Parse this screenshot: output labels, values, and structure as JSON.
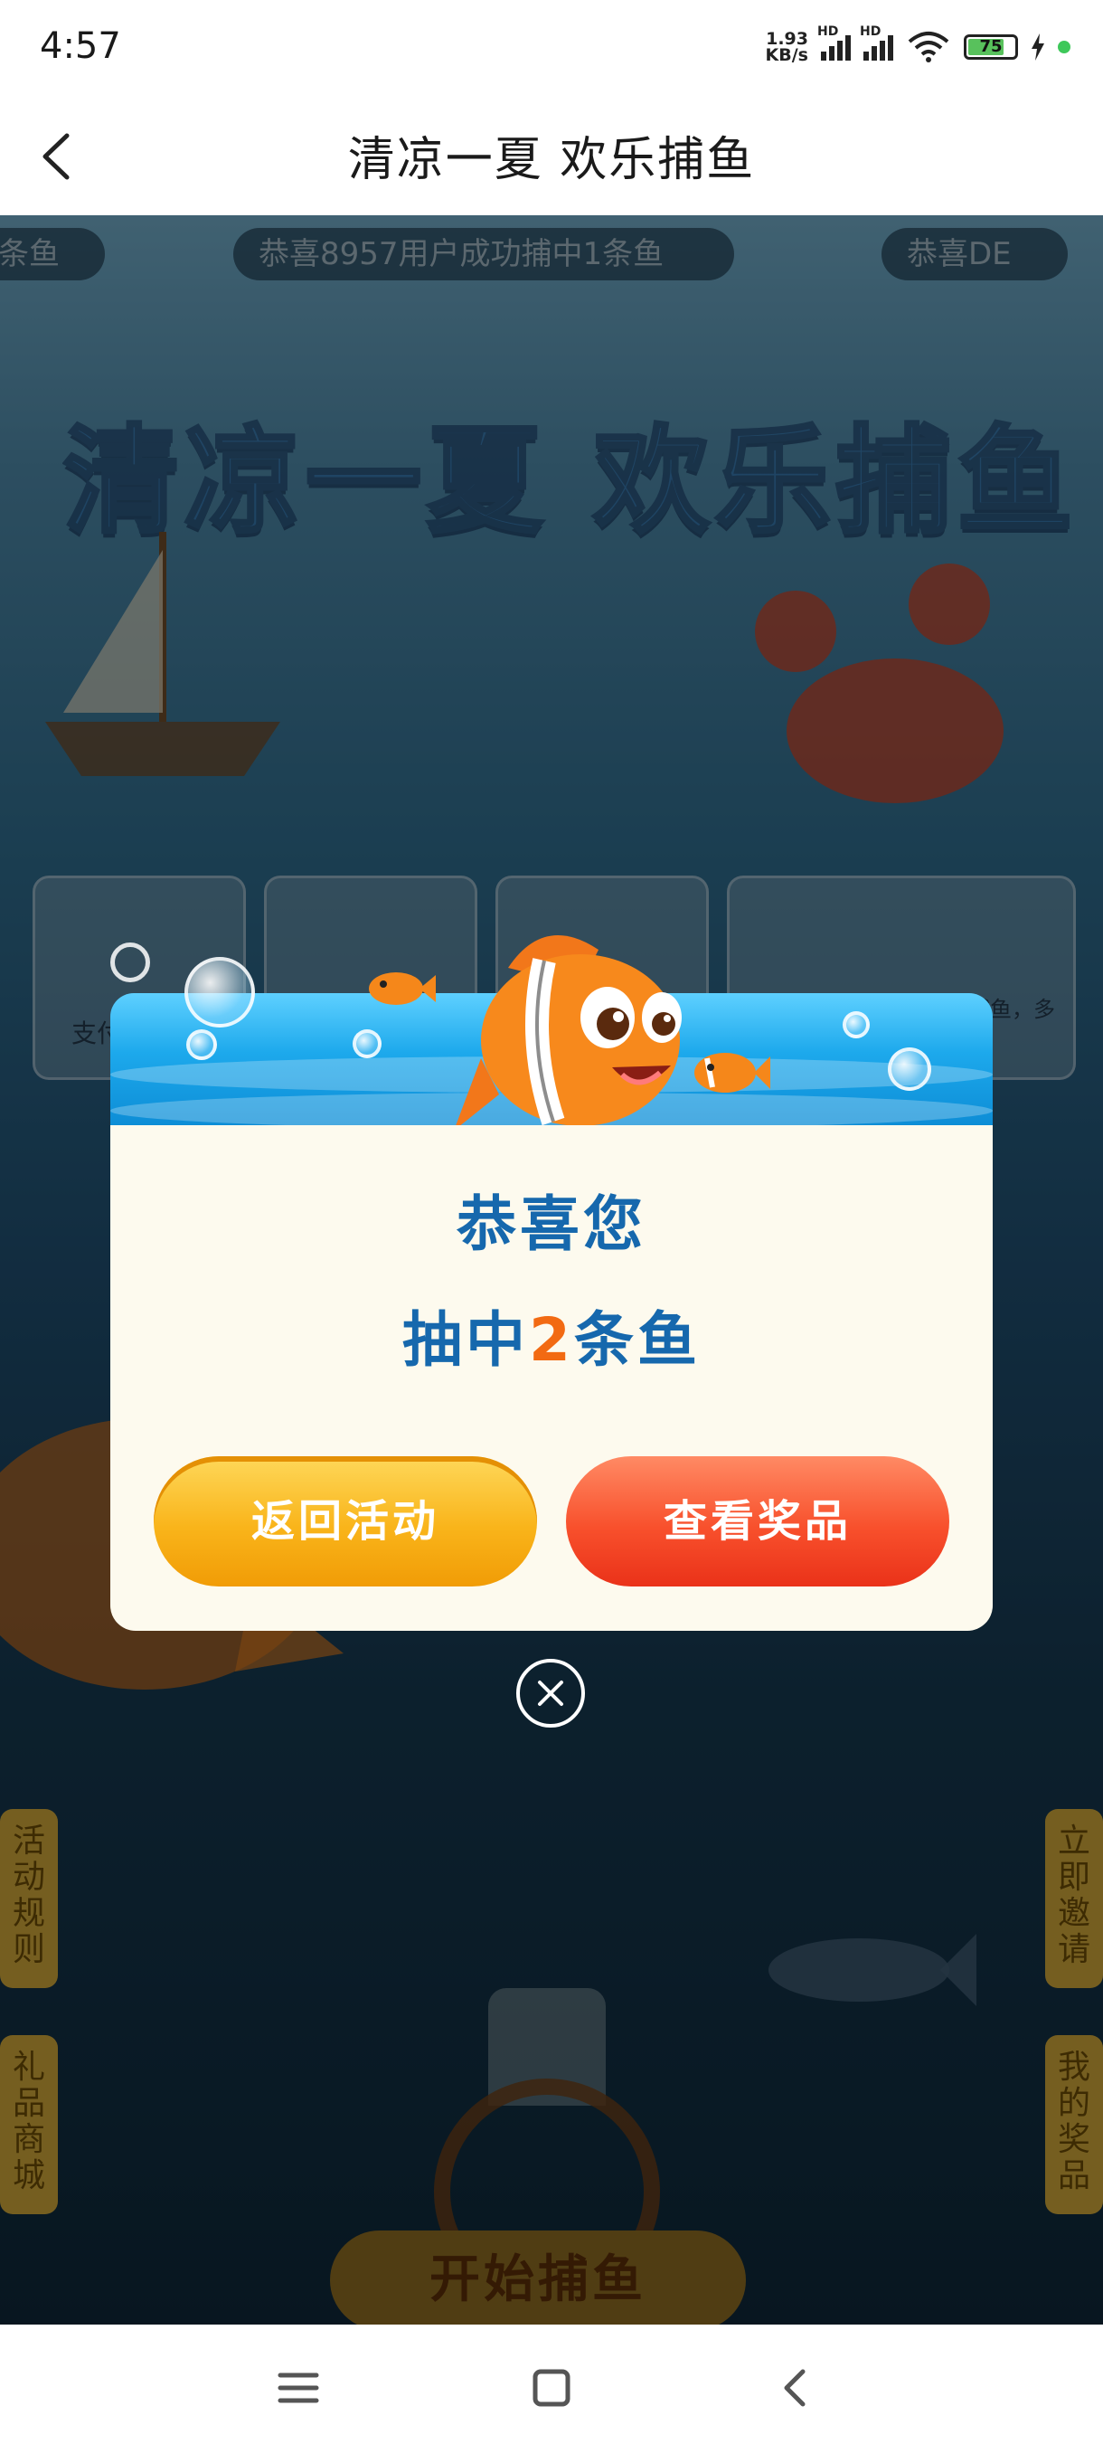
{
  "status_bar": {
    "time": "4:57",
    "net_speed_value": "1.93",
    "net_speed_unit": "KB/s",
    "signal_label_1": "HD",
    "signal_label_2": "HD",
    "battery": "75",
    "icons": [
      "signal-icon",
      "wifi-icon",
      "battery-icon",
      "charging-icon"
    ]
  },
  "header": {
    "title": "清凉一夏 欢乐捕鱼",
    "back_icon": "chevron-left-icon"
  },
  "game": {
    "ticker": [
      "条鱼",
      "恭喜8957用户成功捕中1条鱼",
      "恭喜DE"
    ],
    "banner_title": "清凉一夏 欢乐捕鱼",
    "cards": [
      "支付",
      "",
      "",
      "付捕鱼，多可邀"
    ],
    "side_left": [
      "活动规则",
      "礼品商城"
    ],
    "side_right": [
      "立即邀请",
      "我的奖品"
    ],
    "start_button": "开始捕鱼"
  },
  "modal": {
    "title": "恭喜您",
    "result_prefix": "抽中",
    "result_number": "2",
    "result_suffix": "条鱼",
    "btn_back": "返回活动",
    "btn_view": "查看奖品",
    "close_icon": "close-circle-icon"
  },
  "nav_bar": {
    "icons": [
      "menu-icon",
      "home-square-icon",
      "back-triangle-icon"
    ]
  },
  "colors": {
    "accent_blue": "#1668ad",
    "accent_orange": "#f26a12",
    "btn_yellow": "#f9b41a",
    "btn_red": "#f8502c"
  }
}
